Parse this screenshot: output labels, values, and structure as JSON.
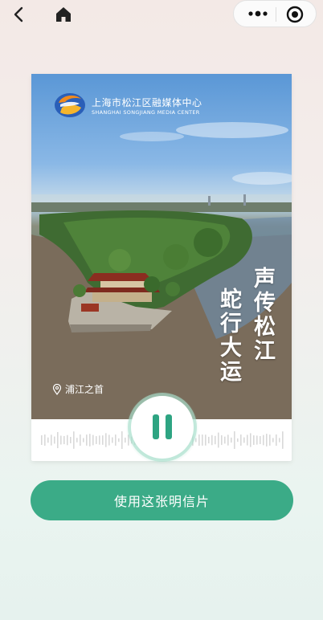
{
  "nav": {
    "back_icon": "chevron-left-icon",
    "home_icon": "home-icon",
    "more_icon": "more-dots-icon",
    "close_icon": "target-close-icon"
  },
  "card": {
    "org_name_cn": "上海市松江区融媒体中心",
    "org_name_en": "SHANGHAI SONGJIANG MEDIA CENTER",
    "title_col1": "声传松江",
    "title_col2": "蛇行大运",
    "location": "浦江之首",
    "location_icon": "location-pin-icon"
  },
  "player": {
    "state_icon": "pause-icon",
    "accent": "#2ea482"
  },
  "actions": {
    "use_postcard_label": "使用这张明信片",
    "accent": "#3bab87"
  }
}
